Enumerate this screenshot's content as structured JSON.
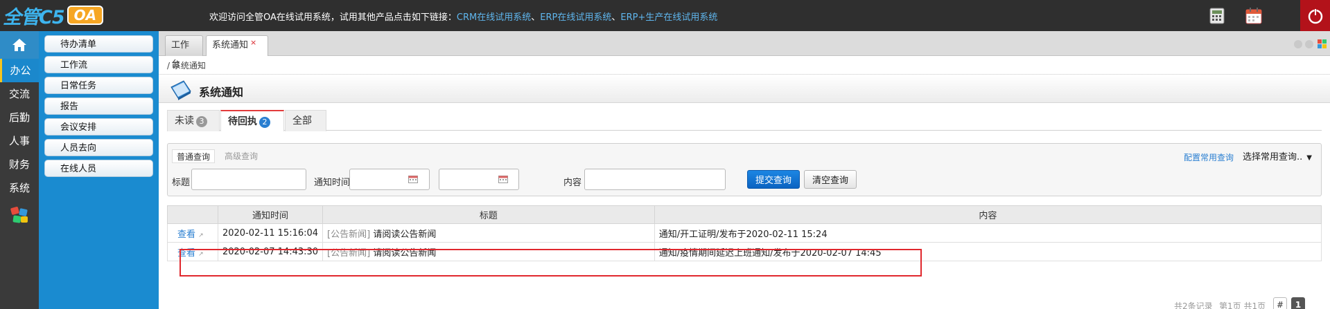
{
  "app": {
    "logo_main": "全管C5",
    "logo_oa": "OA"
  },
  "header": {
    "welcome_text": "欢迎访问全管OA在线试用系统，试用其他产品点击如下链接：",
    "links": [
      "CRM在线试用系统",
      "ERP在线试用系统",
      "ERP+生产在线试用系统"
    ],
    "link_separator": "、"
  },
  "leftnav": {
    "items": [
      "办公",
      "交流",
      "后勤",
      "人事",
      "财务",
      "系统"
    ],
    "active_index": 0
  },
  "submenu": {
    "items": [
      "待办清单",
      "工作流",
      "日常任务",
      "报告",
      "会议安排",
      "人员去向",
      "在线人员"
    ]
  },
  "tabs": [
    {
      "label": "工作台"
    },
    {
      "label": "系统通知",
      "close": "×"
    }
  ],
  "breadcrumb": "/ 系统通知",
  "page_title": "系统通知",
  "status_tabs": [
    {
      "label": "未读",
      "count": "3"
    },
    {
      "label": "待回执",
      "count": "2"
    },
    {
      "label": "全部"
    }
  ],
  "search": {
    "types": [
      "普通查询",
      "高级查询"
    ],
    "config_link": "配置常用查询",
    "select_query": "选择常用查询..",
    "fields": {
      "title_label": "标题",
      "title_value": "",
      "time_label": "通知时间",
      "time_from": "",
      "time_to": "",
      "time_dash": "-",
      "content_label": "内容",
      "content_value": ""
    },
    "submit_label": "提交查询",
    "clear_label": "清空查询"
  },
  "table": {
    "columns": [
      "",
      "通知时间",
      "标题",
      "内容"
    ],
    "rows": [
      {
        "action": "查看",
        "time": "2020-02-11 15:16:04",
        "category": "[公告新闻]",
        "title": "请阅读公告新闻",
        "content": "通知/开工证明/发布于2020-02-11 15:24"
      },
      {
        "action": "查看",
        "time": "2020-02-07 14:43:30",
        "category": "[公告新闻]",
        "title": "请阅读公告新闻",
        "content": "通知/疫情期间延迟上班通知/发布于2020-02-07 14:45"
      }
    ]
  },
  "pager": {
    "total": "共2条记录",
    "pages": "第1页 共1页",
    "hash": "#",
    "current": "1"
  },
  "colors": {
    "topbar": "#2f2f2f",
    "submenu": "#1a8bd0",
    "link": "#2a7fd1",
    "highlight": "#e0272d",
    "primary_button": "#0b63c1",
    "power": "#b3121a"
  }
}
